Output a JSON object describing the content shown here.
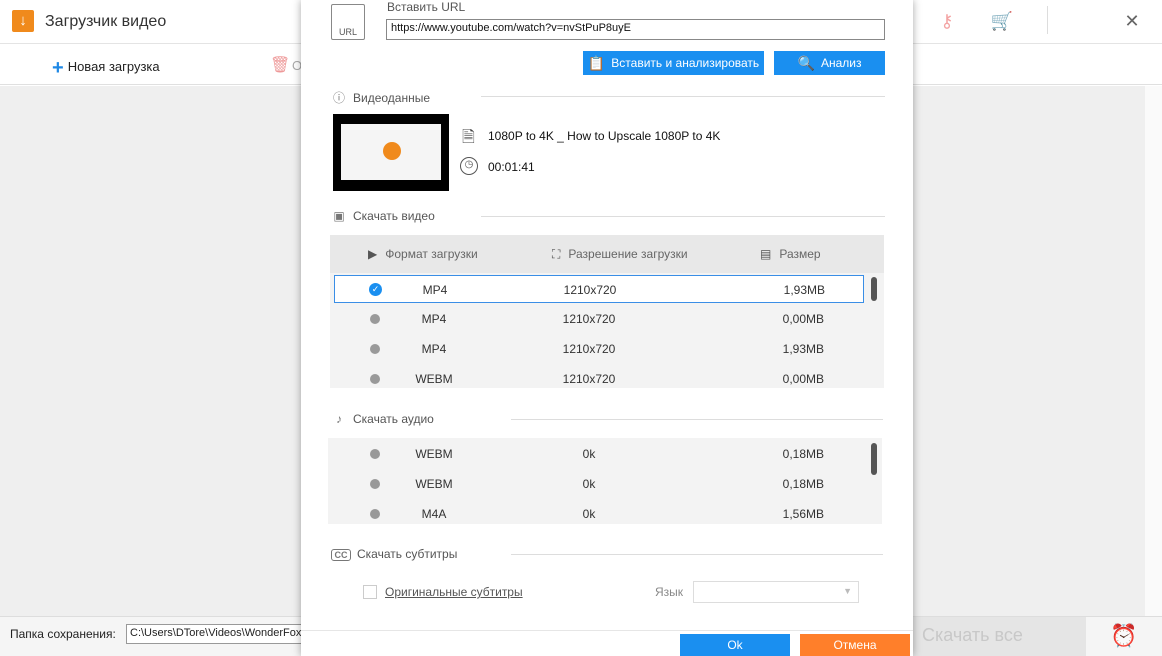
{
  "window": {
    "title": "Загрузчик видео",
    "new_download": "Новая загрузка",
    "delete_partial": "О",
    "save_folder_label": "Папка сохранения:",
    "save_folder_path": "C:\\Users\\DTore\\Videos\\WonderFox",
    "download_all": "Скачать все"
  },
  "dialog": {
    "url_label": "Вставить URL",
    "url_icon_text": "URL",
    "url_value": "https://www.youtube.com/watch?v=nvStPuP8uyE",
    "paste_analyze": "Вставить и анализировать",
    "analyze": "Анализ",
    "video_data_header": "Видеоданные",
    "video_title": "1080P to 4K _ How to Upscale 1080P to 4K",
    "video_duration": "00:01:41",
    "download_video_header": "Скачать видео",
    "columns": {
      "format": "Формат загрузки",
      "resolution": "Разрешение загрузки",
      "size": "Размер"
    },
    "video_rows": [
      {
        "format": "MP4",
        "resolution": "1210x720",
        "size": "1,93MB",
        "selected": true
      },
      {
        "format": "MP4",
        "resolution": "1210x720",
        "size": "0,00MB",
        "selected": false
      },
      {
        "format": "MP4",
        "resolution": "1210x720",
        "size": "1,93MB",
        "selected": false
      },
      {
        "format": "WEBM",
        "resolution": "1210x720",
        "size": "0,00MB",
        "selected": false
      }
    ],
    "download_audio_header": "Скачать аудио",
    "audio_rows": [
      {
        "format": "WEBM",
        "bitrate": "0k",
        "size": "0,18MB"
      },
      {
        "format": "WEBM",
        "bitrate": "0k",
        "size": "0,18MB"
      },
      {
        "format": "M4A",
        "bitrate": "0k",
        "size": "1,56MB"
      }
    ],
    "download_subs_header": "Скачать субтитры",
    "subs_icon_text": "CC",
    "original_subs": "Оригинальные субтитры",
    "language_label": "Язык",
    "ok": "Ok",
    "cancel": "Отмена"
  },
  "accent_colors": {
    "primary": "#1a8ff0",
    "cancel": "#ff7f2a",
    "brand": "#f08a1c"
  }
}
